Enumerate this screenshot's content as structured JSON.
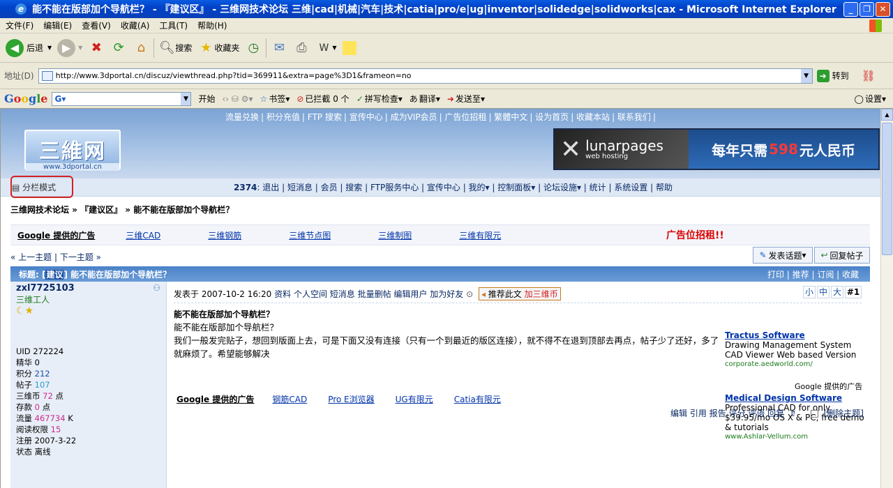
{
  "window": {
    "title": "能不能在版部加个导航栏？ - 『建议区』 - 三维网技术论坛 三维|cad|机械|汽车|技术|catia|pro/e|ug|inventor|solidedge|solidworks|cax - Microsoft Internet Explorer"
  },
  "menu": [
    "文件(F)",
    "编辑(E)",
    "查看(V)",
    "收藏(A)",
    "工具(T)",
    "帮助(H)"
  ],
  "toolbar": {
    "back": "后退",
    "search": "搜索",
    "favorites": "收藏夹"
  },
  "address": {
    "label": "地址(D)",
    "url": "http://www.3dportal.cn/discuz/viewthread.php?tid=369911&extra=page%3D1&frameon=no",
    "go": "转到"
  },
  "googlebar": {
    "logo": "Google",
    "start": "开始",
    "bookmarks": "书签",
    "blocked": "已拦截 0 个",
    "spell": "拼写检查",
    "translate": "翻译",
    "sendto": "发送至",
    "settings": "设置"
  },
  "site": {
    "topnav": [
      "流量兑换",
      "积分充值",
      "FTP 搜索",
      "宣传中心",
      "成为VIP会员",
      "广告位招租",
      "繁體中文",
      "设为首页",
      "收藏本站",
      "联系我们"
    ],
    "logo_big": "三維网",
    "logo_small": "www.3dportal.cn",
    "banner_brand": "lunarpages",
    "banner_sub": "web hosting",
    "banner_pre": "每年只需",
    "banner_num": "598",
    "banner_post": "元人民币",
    "mode": "分栏模式",
    "uid_num": "2374",
    "navlinks": "退出 | 短消息 | 会员 | 搜索 | FTP服务中心 | 宣传中心 | 我的▾ | 控制面板▾ | 论坛设施▾ | 统计 | 系统设置 | 帮助",
    "breadcrumb": "三维网技术论坛 » 『建议区』 » 能不能在版部加个导航栏？"
  },
  "ads": {
    "label": "Google 提供的广告",
    "links": [
      "三维CAD",
      "三维钢筋",
      "三维节点图",
      "三维制图",
      "三维有限元"
    ],
    "red": "广告位招租!!"
  },
  "thread": {
    "prev": "« 上一主题",
    "next": "下一主题 »",
    "post_btn": "发表话题",
    "reply_btn": "回复帖子",
    "title_prefix": "标题: [",
    "title_tag": "建议",
    "title_rest": "] 能不能在版部加个导航栏？",
    "actions": "打印 | 推荐 | 订阅 | 收藏"
  },
  "user": {
    "name": "zxl7725103",
    "rank": "三维工人",
    "stars": "☾★",
    "uid": "UID 272224",
    "jinghua": "精华  0",
    "jifen_l": "积分  ",
    "jifen": "212",
    "tiezi_l": "帖子  ",
    "tiezi": "107",
    "coin_l": "三维币  ",
    "coin": "72",
    "coin_u": " 点",
    "cun_l": "存款  ",
    "cun": "0",
    "cun_u": " 点",
    "flow_l": "流量  ",
    "flow": "467734",
    "flow_u": " K",
    "read_l": "阅读权限  ",
    "read": "15",
    "reg": "注册  2007-3-22",
    "status": "状态  离线"
  },
  "post": {
    "meta_time": "发表于 2007-10-2 16:20",
    "meta_links": "资料  个人空间  短消息  批量删帖  编辑用户  加为好友",
    "recommend": "推荐此文",
    "recommend_r": "加三维币",
    "sizes": [
      "小",
      "中",
      "大"
    ],
    "floor": "#1",
    "title": "能不能在版部加个导航栏？",
    "line1": "能不能在版部加个导航栏？",
    "line2": "我们一般发完贴子，想回到版面上去，可是下面又没有连接（只有一个到最近的版区连接），就不得不在退到顶部去再点，帖子少了还好，多了就麻烦了。希望能够解决"
  },
  "sideads": [
    {
      "h": "Tractus Software",
      "d": "Drawing Management System CAD Viewer Web based Version",
      "u": "corporate.aedworld.com/"
    },
    {
      "h": "Medical Design Software",
      "d": "Professional CAD for only $39.95/mo OS X & PC, free demo & tutorials",
      "u": "www.Ashlar-Vellum.com"
    }
  ],
  "gad": "Google 提供的广告",
  "bottomads": {
    "label": "Google 提供的广告",
    "links": [
      "钢筋CAD",
      "Pro E浏览器",
      "UG有限元",
      "Catia有限元"
    ]
  },
  "postactions": "编辑  引用  报告  评分  评语  回复",
  "delete": "[删除主题]"
}
